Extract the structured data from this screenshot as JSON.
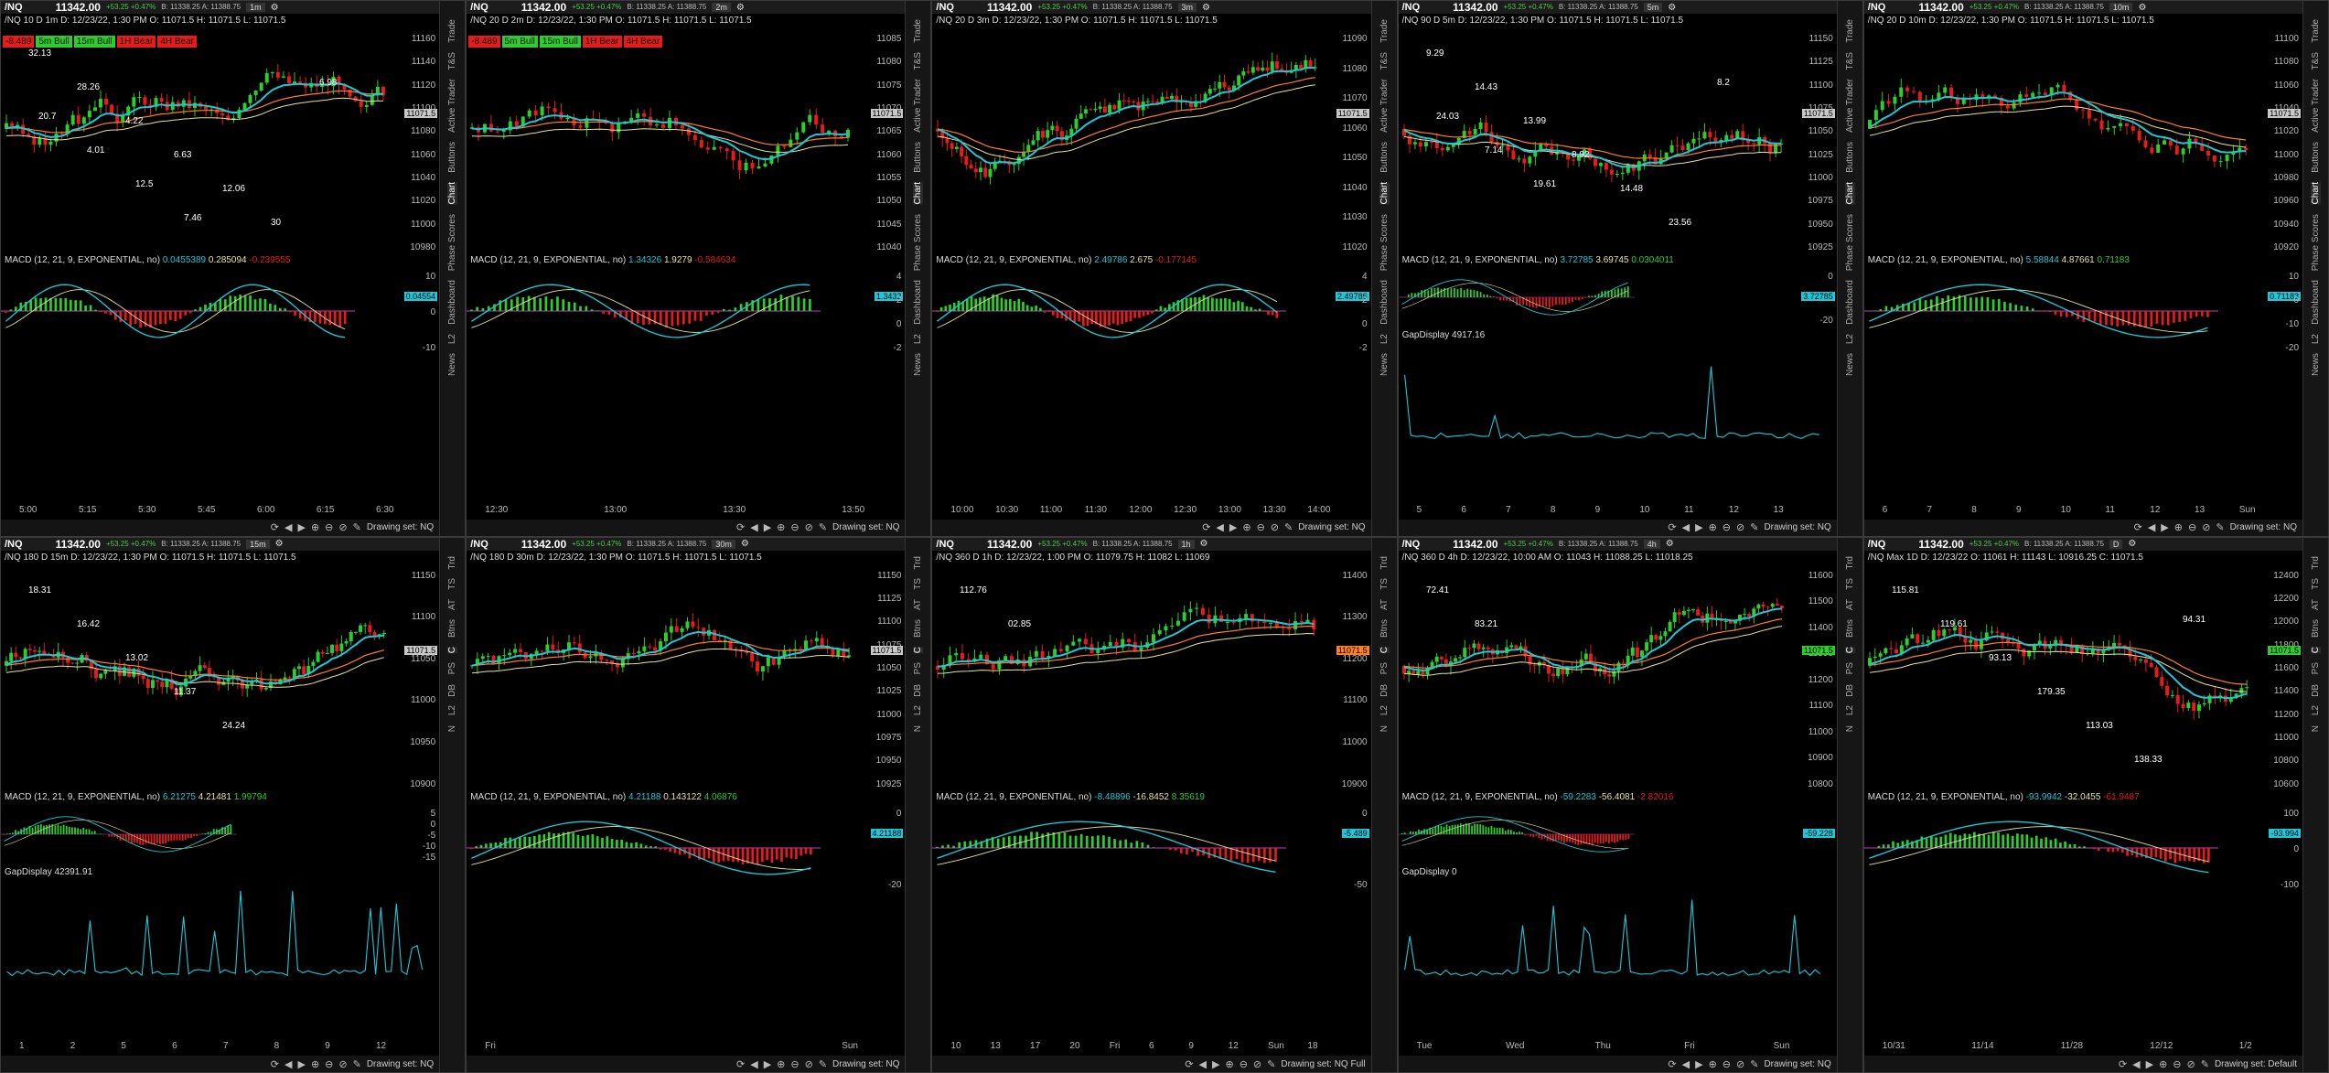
{
  "colors": {
    "bull": "#2ecc2e",
    "bear": "#e51c1c",
    "cyan": "#1ec8d8",
    "orange": "#ff7f27",
    "yellow": "#e8e2a0"
  },
  "common": {
    "last": "11342.00",
    "chg": "+53.25 +0.47%",
    "bidask": "B: 11338.25 A: 11388.75",
    "macd_label": "MACD (12, 21, 9, EXPONENTIAL, no)",
    "tabs_long": [
      "Trade",
      "T&S",
      "Active Trader",
      "Buttons",
      "Chart",
      "Phase Scores",
      "Dashboard",
      "L2",
      "News"
    ],
    "tabs_short": [
      "Trd",
      "TS",
      "AT",
      "Btns",
      "C",
      "PS",
      "DB",
      "L2",
      "N"
    ],
    "drawing_label": "Drawing set:"
  },
  "panels": [
    {
      "symbol": "/NQ",
      "tf": "1m",
      "info": "/NQ 10 D 1m  D: 12/23/22, 1:30 PM  O: 11071.5  H: 11071.5  L: 11071.5",
      "signals": [
        [
          "-8.489",
          "bear"
        ],
        [
          "5m Bull",
          "bull"
        ],
        [
          "15m Bull",
          "bull"
        ],
        [
          "1H Bear",
          "bear"
        ],
        [
          "4H Bear",
          "bear"
        ]
      ],
      "yticks": [
        "11160",
        "11140",
        "11120",
        "11100",
        "11080",
        "11060",
        "11040",
        "11020",
        "11000",
        "10980"
      ],
      "price_tag": "11071.5",
      "tag_color": "#c8c8c8",
      "macd": [
        "0.0455389",
        "0.285094",
        "-0.239555"
      ],
      "macd_ticks": [
        "10",
        "0",
        "-10"
      ],
      "macd_tag": "0.04554",
      "xticks": [
        "5:00",
        "5:15",
        "5:30",
        "5:45",
        "6:00",
        "6:15",
        "6:30"
      ],
      "drawing": "NQ",
      "gap": "",
      "annotations": [
        "32.13",
        "28.26",
        "4.22",
        "6.63",
        "12.06",
        "30",
        "6.98",
        "20.7",
        "4.01",
        "12.5",
        "7.46"
      ]
    },
    {
      "symbol": "/NQ",
      "tf": "2m",
      "info": "/NQ 20 D 2m  D: 12/23/22, 1:30 PM  O: 11071.5  H: 11071.5  L: 11071.5",
      "signals": [
        [
          "-8.489",
          "bear"
        ],
        [
          "5m Bull",
          "bull"
        ],
        [
          "15m Bull",
          "bull"
        ],
        [
          "1H Bear",
          "bear"
        ],
        [
          "4H Bear",
          "bear"
        ]
      ],
      "yticks": [
        "11085",
        "11080",
        "11075",
        "11070",
        "11065",
        "11060",
        "11055",
        "11050",
        "11045",
        "11040"
      ],
      "price_tag": "11071.5",
      "tag_color": "#c8c8c8",
      "macd": [
        "1.34326",
        "1.9279",
        "-0.584634"
      ],
      "macd_ticks": [
        "4",
        "2",
        "0",
        "-2"
      ],
      "macd_tag": "1.3432",
      "xticks": [
        "12:30",
        "13:00",
        "13:30",
        "13:50"
      ],
      "drawing": "NQ",
      "gap": "",
      "annotations": []
    },
    {
      "symbol": "/NQ",
      "tf": "3m",
      "info": "/NQ 20 D 3m  D: 12/23/22, 1:30 PM  O: 11071.5  H: 11071.5  L: 11071.5",
      "signals": [],
      "yticks": [
        "11090",
        "11080",
        "11070",
        "11060",
        "11050",
        "11040",
        "11030",
        "11020"
      ],
      "price_tag": "11071.5",
      "tag_color": "#c8c8c8",
      "macd": [
        "2.49786",
        "2.675",
        "-0.177145"
      ],
      "macd_ticks": [
        "4",
        "2",
        "0",
        "-2"
      ],
      "macd_tag": "2.49786",
      "xticks": [
        "10:00",
        "10:30",
        "11:00",
        "11:30",
        "12:00",
        "12:30",
        "13:00",
        "13:30",
        "14:00"
      ],
      "drawing": "NQ",
      "gap": "",
      "annotations": []
    },
    {
      "symbol": "/NQ",
      "tf": "5m",
      "info": "/NQ 90 D 5m  D: 12/23/22, 1:30 PM  O: 11071.5  H: 11071.5  L: 11071.5",
      "signals": [],
      "yticks": [
        "11150",
        "11125",
        "11100",
        "11075",
        "11050",
        "11025",
        "11000",
        "10975",
        "10950",
        "10925"
      ],
      "price_tag": "11071.5",
      "tag_color": "#c8c8c8",
      "macd": [
        "3.72785",
        "3.69745",
        "0.0304011"
      ],
      "macd_ticks": [
        "0",
        "-20"
      ],
      "macd_tag": "3.72785",
      "xticks": [
        "5",
        "6",
        "7",
        "8",
        "9",
        "10",
        "11",
        "12",
        "13"
      ],
      "drawing": "NQ",
      "gap": "GapDisplay  4917.16",
      "annotations": [
        "9.29",
        "14.43",
        "13.99",
        "8.92",
        "14.48",
        "23.56",
        "8.2",
        "24.03",
        "7.14",
        "19.61"
      ]
    },
    {
      "symbol": "/NQ",
      "tf": "10m",
      "info": "/NQ 20 D 10m  D: 12/23/22, 1:30 PM  O: 11071.5  H: 11071.5  L: 11071.5",
      "signals": [],
      "yticks": [
        "11100",
        "11080",
        "11060",
        "11040",
        "11020",
        "11000",
        "10980",
        "10960",
        "10940",
        "10920"
      ],
      "price_tag": "11071.5",
      "tag_color": "#c8c8c8",
      "macd": [
        "5.58844",
        "4.87661",
        "0.71183"
      ],
      "macd_ticks": [
        "10",
        "0",
        "-10",
        "-20"
      ],
      "macd_tag": "0.71183",
      "xticks": [
        "6",
        "7",
        "8",
        "9",
        "10",
        "11",
        "12",
        "13",
        "Sun"
      ],
      "drawing": "NQ",
      "gap": "",
      "annotations": []
    },
    {
      "symbol": "/NQ",
      "tf": "15m",
      "info": "/NQ 180 D 15m  D: 12/23/22, 1:30 PM  O: 11071.5  H: 11071.5  L: 11071.5",
      "signals": [],
      "yticks": [
        "11150",
        "11100",
        "11050",
        "11000",
        "10950",
        "10900"
      ],
      "price_tag": "11071.5",
      "tag_color": "#c8c8c8",
      "macd": [
        "6.21275",
        "4.21481",
        "1.99794"
      ],
      "macd_ticks": [
        "5",
        "0",
        "-5",
        "-10",
        "-15"
      ],
      "macd_tag": "",
      "xticks": [
        "1",
        "2",
        "5",
        "6",
        "7",
        "8",
        "9",
        "12"
      ],
      "drawing": "NQ",
      "gap": "GapDisplay  42391.91",
      "annotations": [
        "18.31",
        "16.42",
        "13.02",
        "11.37",
        "24.24"
      ]
    },
    {
      "symbol": "/NQ",
      "tf": "30m",
      "info": "/NQ 180 D 30m  D: 12/23/22, 1:30 PM  O: 11071.5  H: 11071.5  L: 11071.5",
      "signals": [],
      "yticks": [
        "11150",
        "11125",
        "11100",
        "11075",
        "11050",
        "11025",
        "11000",
        "10975",
        "10950",
        "10925"
      ],
      "price_tag": "11071.5",
      "tag_color": "#c8c8c8",
      "macd": [
        "4.21188",
        "0.143122",
        "4.06876"
      ],
      "macd_ticks": [
        "0",
        "-20"
      ],
      "macd_tag": "4.21188",
      "xticks": [
        "Fri",
        "Sun"
      ],
      "drawing": "NQ",
      "gap": "",
      "annotations": []
    },
    {
      "symbol": "/NQ",
      "tf": "1h",
      "info": "/NQ 360 D 1h  D: 12/23/22, 1:00 PM  O: 11079.75  H: 11082  L: 11069",
      "signals": [],
      "yticks": [
        "11400",
        "11300",
        "11200",
        "11100",
        "11000",
        "10900"
      ],
      "price_tag": "11071.5",
      "tag_color": "#ff7f27",
      "macd": [
        "-8.48896",
        "-16.8452",
        "8.35619"
      ],
      "macd_ticks": [
        "0",
        "-50"
      ],
      "macd_tag": "-5.489",
      "xticks": [
        "10",
        "13",
        "17",
        "20",
        "Fri",
        "6",
        "9",
        "12",
        "Sun",
        "18"
      ],
      "drawing": "NQ Full",
      "gap": "",
      "annotations": [
        "112.76",
        "02.85"
      ]
    },
    {
      "symbol": "/NQ",
      "tf": "4h",
      "info": "/NQ 360 D 4h  D: 12/23/22, 10:00 AM  O: 11043  H: 11088.25  L: 11018.25",
      "signals": [],
      "yticks": [
        "11600",
        "11500",
        "11400",
        "11300",
        "11200",
        "11100",
        "11000",
        "10900",
        "10800"
      ],
      "price_tag": "11071.5",
      "tag_color": "#2ecc2e",
      "macd": [
        "-59.2283",
        "-56.4081",
        "-2.82016"
      ],
      "macd_ticks": [],
      "macd_tag": "-59.228",
      "xticks": [
        "Tue",
        "Wed",
        "Thu",
        "Fri",
        "Sun"
      ],
      "drawing": "NQ",
      "gap": "GapDisplay  0",
      "annotations": [
        "72.41",
        "83.21"
      ]
    },
    {
      "symbol": "/NQ",
      "tf": "D",
      "info": "/NQ Max 1D  D: 12/23/22  O: 11061  H: 11143  L: 10916.25  C: 11071.5",
      "signals": [],
      "yticks": [
        "12400",
        "12200",
        "12000",
        "11800",
        "11600",
        "11400",
        "11200",
        "11000",
        "10800",
        "10600"
      ],
      "price_tag": "11071.5",
      "tag_color": "#2ecc2e",
      "macd": [
        "-93.9942",
        "-32.0455",
        "-61.9487"
      ],
      "macd_ticks": [
        "100",
        "0",
        "-100"
      ],
      "macd_tag": "-93.994",
      "xticks": [
        "10/31",
        "11/14",
        "11/28",
        "12/12",
        "1/2"
      ],
      "drawing": "Default",
      "gap": "",
      "annotations": [
        "115.81",
        "119.61",
        "93.13",
        "179.35",
        "113.03",
        "138.33",
        "94.31"
      ]
    }
  ]
}
